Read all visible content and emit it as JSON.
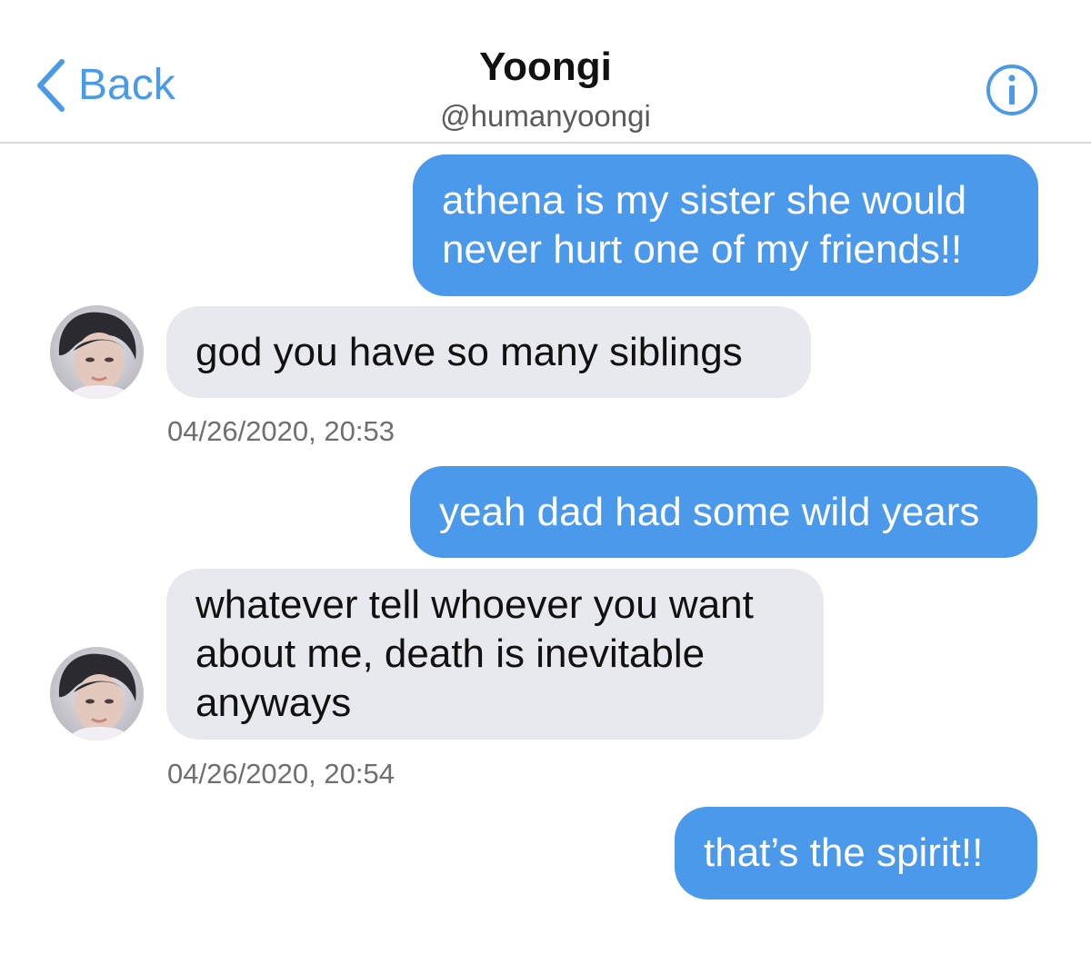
{
  "header": {
    "back_label": "Back",
    "title": "Yoongi",
    "handle": "@humanyoongi",
    "info_icon": "info-circle-icon"
  },
  "colors": {
    "accent": "#4a9ae8",
    "outgoing_bubble": "#4a99eb",
    "incoming_bubble": "#e8e9ee",
    "timestamp": "#6e6e73"
  },
  "messages": [
    {
      "direction": "outgoing",
      "text": "athena is my sister she would\nnever hurt one of my friends!!"
    },
    {
      "direction": "incoming",
      "text": "god you have so many siblings"
    },
    {
      "direction": "timestamp",
      "text": "04/26/2020, 20:53"
    },
    {
      "direction": "outgoing",
      "text": "yeah dad had some wild years"
    },
    {
      "direction": "incoming",
      "text": "whatever tell whoever you want\nabout me, death is inevitable\nanyways"
    },
    {
      "direction": "timestamp",
      "text": "04/26/2020, 20:54"
    },
    {
      "direction": "outgoing",
      "text": "that’s the spirit!!"
    }
  ]
}
